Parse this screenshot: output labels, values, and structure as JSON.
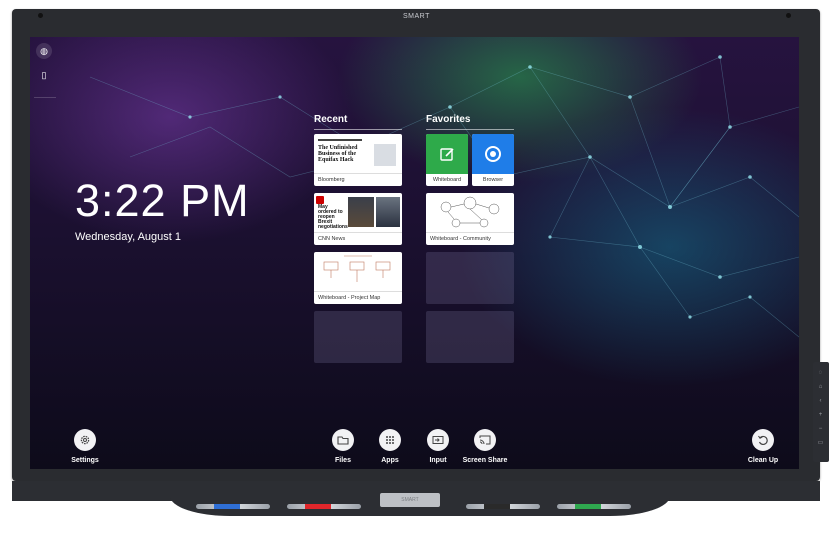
{
  "device": {
    "brand_logo": "SMART",
    "tray_logo": "SMART"
  },
  "home": {
    "time": "3:22 PM",
    "date": "Wednesday, August 1"
  },
  "recent": {
    "title": "Recent",
    "items": [
      {
        "label": "Bloomberg",
        "headline": "The Unfinished Business of the Equifax Hack",
        "icon": "newspaper-thumbnail"
      },
      {
        "label": "CNN News",
        "headline": "May ordered to reopen Brexit negotiations",
        "icon": "news-photo-thumbnail"
      },
      {
        "label": "Whiteboard - Project Map",
        "icon": "whiteboard-sketch-thumbnail"
      }
    ]
  },
  "favorites": {
    "title": "Favorites",
    "items": [
      {
        "label": "Whiteboard",
        "icon": "whiteboard-pen-icon",
        "color": "#2eaa4a"
      },
      {
        "label": "Browser",
        "icon": "chrome-icon",
        "color": "#1f7de8"
      },
      {
        "label": "Whiteboard - Community",
        "icon": "whiteboard-diagram-thumbnail"
      }
    ]
  },
  "dock": {
    "settings": "Settings",
    "files": "Files",
    "apps": "Apps",
    "input": "Input",
    "screen_share": "Screen Share",
    "clean_up": "Clean Up"
  },
  "pens": [
    {
      "color": "#2f6fd6"
    },
    {
      "color": "#e0262b"
    },
    {
      "color": "#2a2a2a"
    },
    {
      "color": "#2fa84f"
    }
  ]
}
